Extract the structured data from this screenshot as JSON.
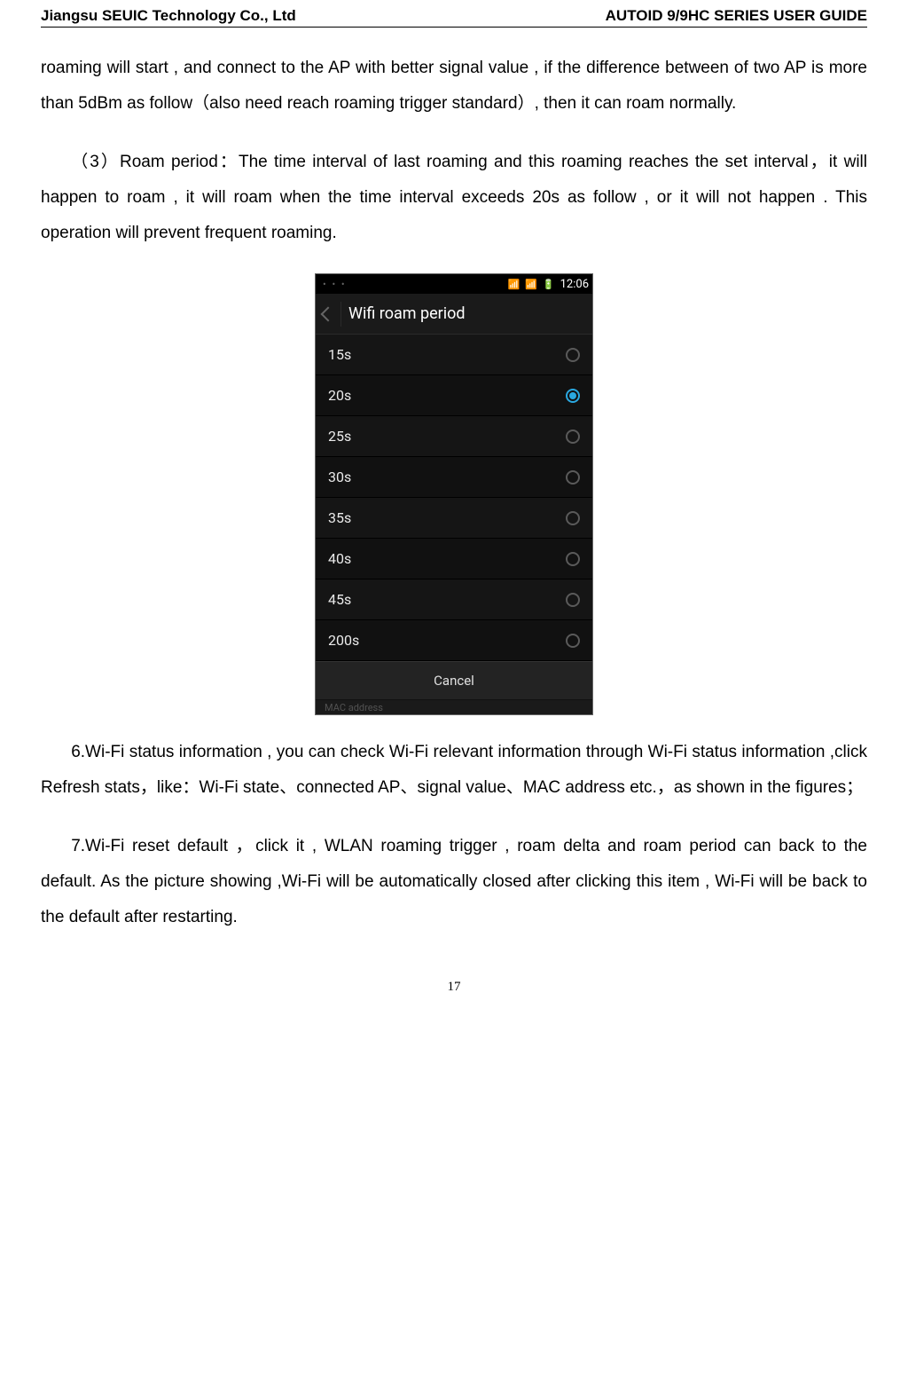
{
  "header": {
    "left": "Jiangsu SEUIC Technology Co., Ltd",
    "right": "AUTOID 9/9HC SERIES USER GUIDE"
  },
  "paragraphs": {
    "p1": "roaming will start , and connect to the AP with better signal value , if the difference between of two AP is more than 5dBm as follow（also need reach roaming trigger standard）, then it can roam normally.",
    "p2": "（3）Roam period：The time interval of last roaming and this roaming reaches the set interval，it will happen to roam , it will roam when the time interval exceeds 20s as follow , or it will not happen . This operation will prevent frequent roaming.",
    "p3": "6.Wi-Fi  status  information  ,  you  can  check  Wi-Fi  relevant  information  through  Wi-Fi status information ,click Refresh stats，like：Wi-Fi state、connected AP、signal value、MAC address etc.，as shown in the figures；",
    "p4": "7.Wi-Fi reset default ，click   it , WLAN roaming trigger , roam delta and roam period can  back  to  the  default.  As  the  picture  showing  ,Wi-Fi  will  be  automatically  closed  after clicking this item , Wi-Fi will be back to the default after restarting."
  },
  "phone": {
    "clock": "12:06",
    "title": "Wifi roam period",
    "options": [
      {
        "label": "15s",
        "selected": false
      },
      {
        "label": "20s",
        "selected": true
      },
      {
        "label": "25s",
        "selected": false
      },
      {
        "label": "30s",
        "selected": false
      },
      {
        "label": "35s",
        "selected": false
      },
      {
        "label": "40s",
        "selected": false
      },
      {
        "label": "45s",
        "selected": false
      },
      {
        "label": "200s",
        "selected": false
      }
    ],
    "cancel": "Cancel",
    "footer_hint": "MAC address"
  },
  "page_number": "17"
}
